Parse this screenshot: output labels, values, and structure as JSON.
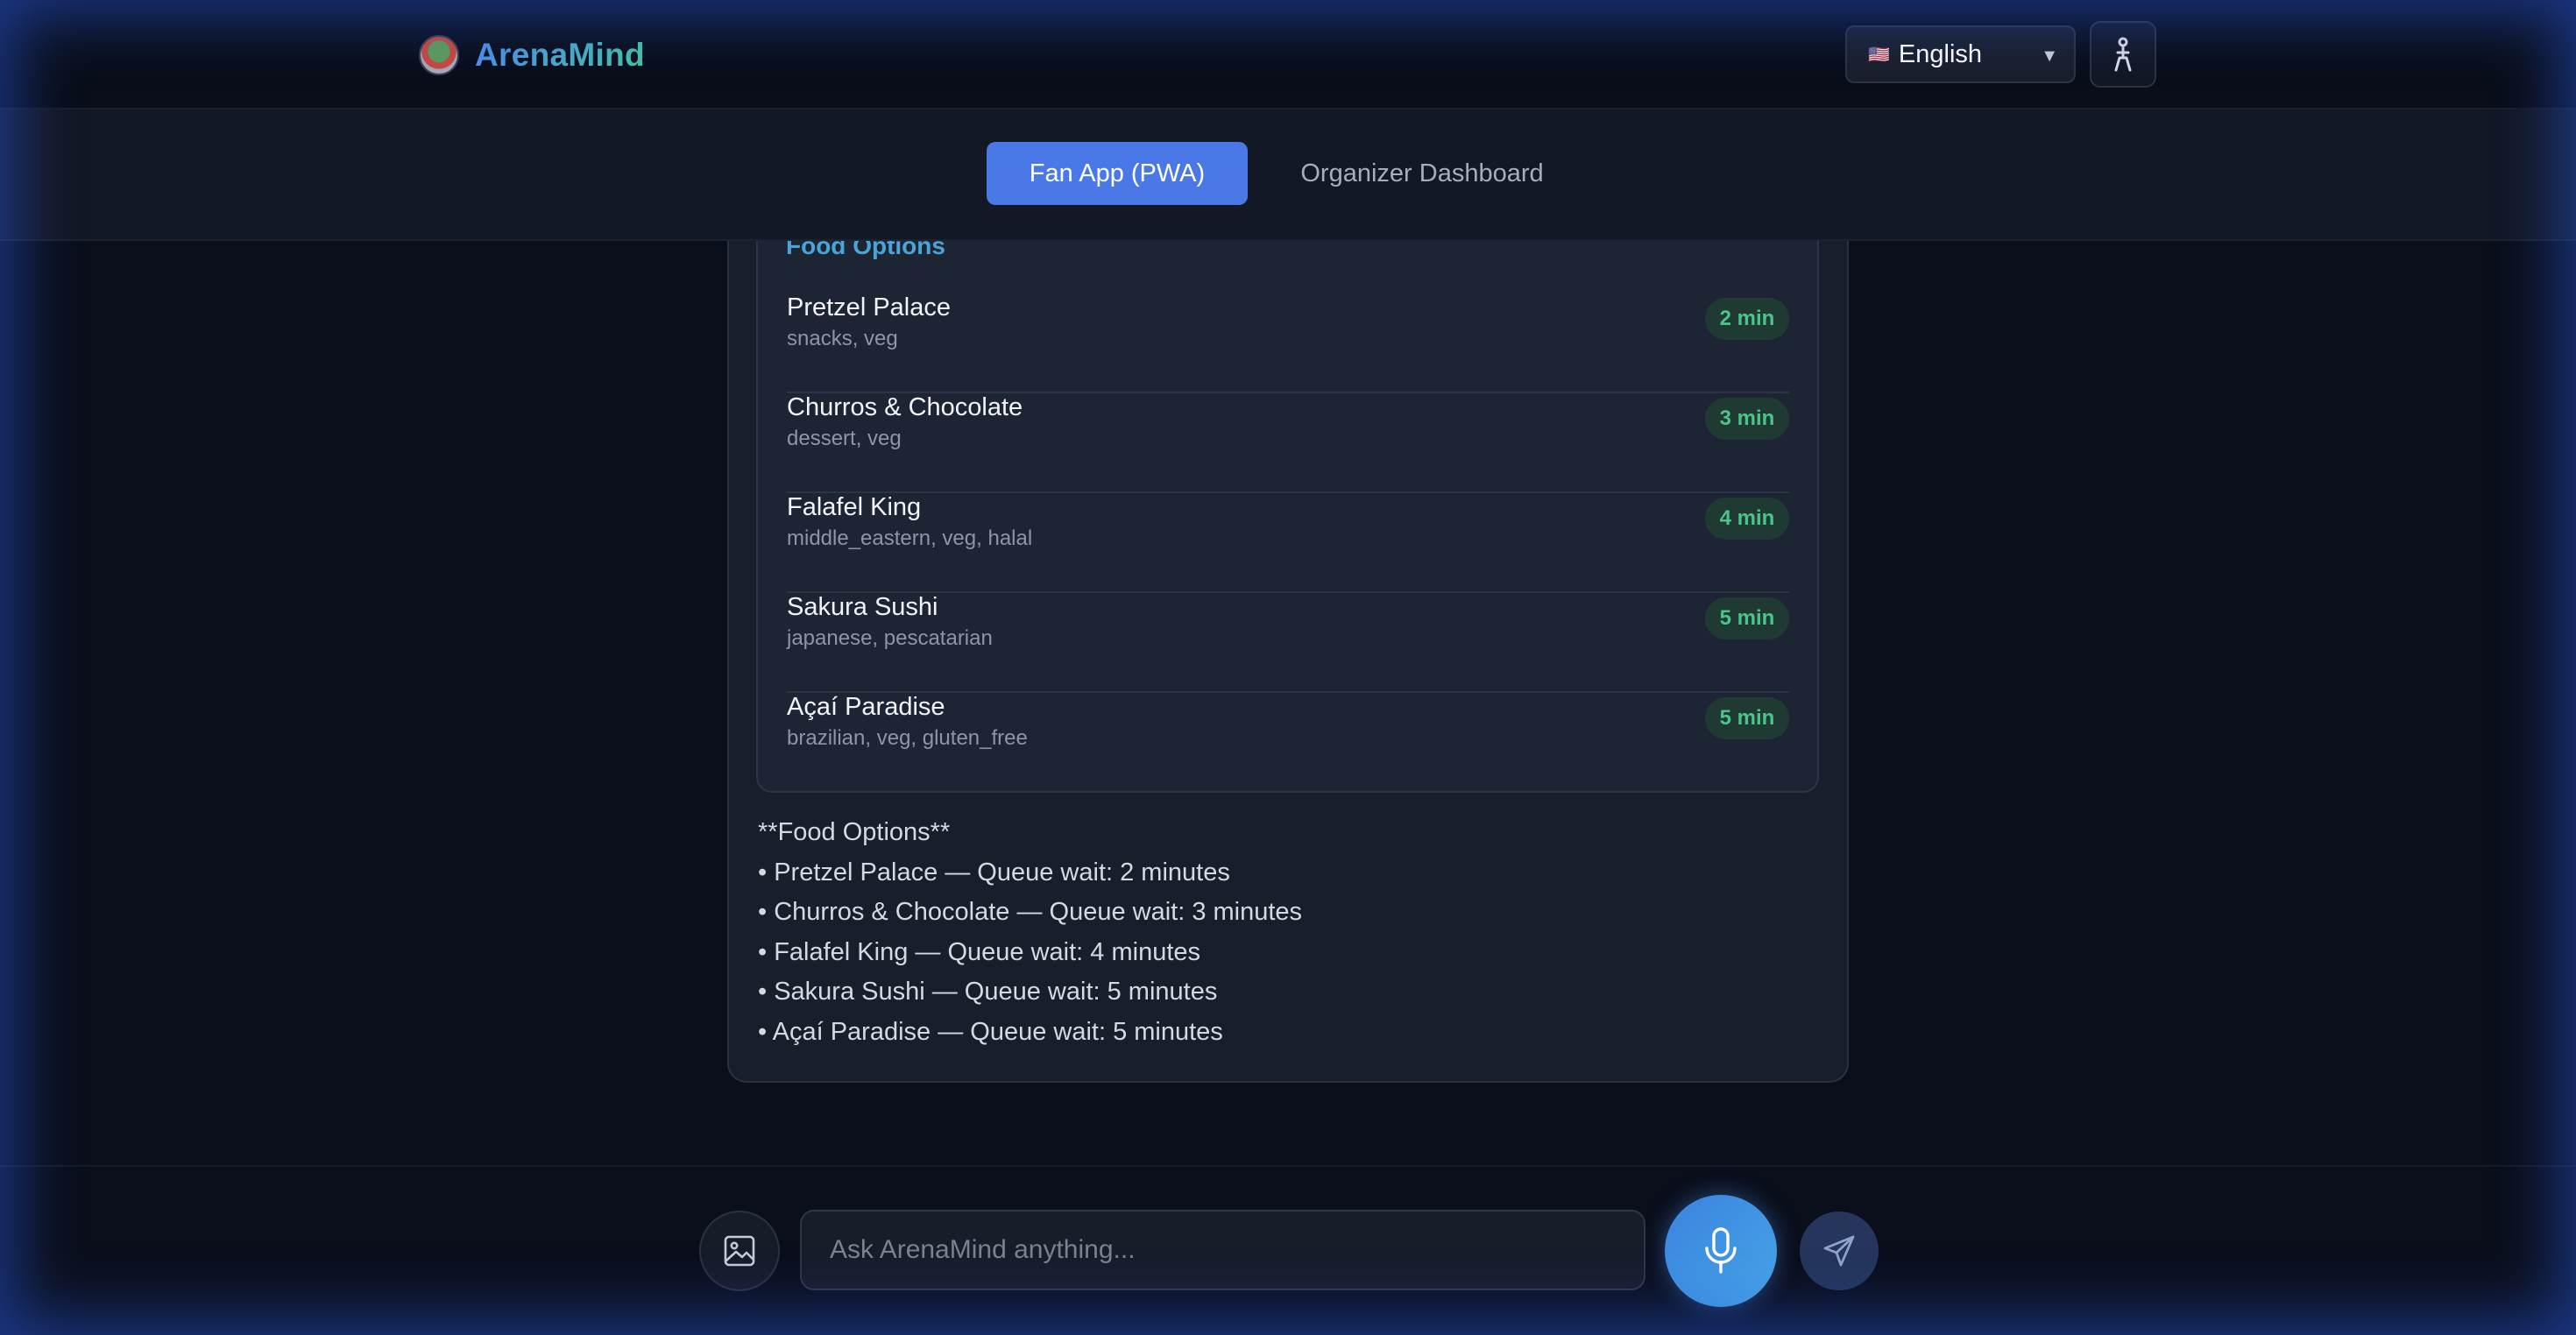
{
  "header": {
    "app_name": "ArenaMind",
    "language": {
      "flag": "🇺🇸",
      "label": "English"
    },
    "accessibility_icon": "accessibility-icon",
    "logo_icon": "stadium-icon"
  },
  "nav": {
    "tabs": [
      {
        "label": "Fan App (PWA)",
        "active": true
      },
      {
        "label": "Organizer Dashboard",
        "active": false
      }
    ]
  },
  "food_card": {
    "title": "Food Options",
    "items": [
      {
        "name": "Pretzel Palace",
        "tags": "snacks, veg",
        "wait": "2 min"
      },
      {
        "name": "Churros & Chocolate",
        "tags": "dessert, veg",
        "wait": "3 min"
      },
      {
        "name": "Falafel King",
        "tags": "middle_eastern, veg, halal",
        "wait": "4 min"
      },
      {
        "name": "Sakura Sushi",
        "tags": "japanese, pescatarian",
        "wait": "5 min"
      },
      {
        "name": "Açaí Paradise",
        "tags": "brazilian, veg, gluten_free",
        "wait": "5 min"
      }
    ]
  },
  "reply": {
    "lines": [
      "**Food Options**",
      "• Pretzel Palace — Queue wait: 2 minutes",
      "• Churros & Chocolate — Queue wait: 3 minutes",
      "• Falafel King — Queue wait: 4 minutes",
      "• Sakura Sushi — Queue wait: 5 minutes",
      "• Açaí Paradise — Queue wait: 5 minutes"
    ]
  },
  "composer": {
    "placeholder": "Ask ArenaMind anything...",
    "value": "",
    "image_icon": "image-icon",
    "mic_icon": "microphone-icon",
    "send_icon": "send-icon"
  },
  "colors": {
    "accent": "#4a78e6",
    "brand_gradient_start": "#4f8ee8",
    "brand_gradient_end": "#46c4a8",
    "wait_badge_text": "#4cc489",
    "food_title": "#4aa5d6"
  }
}
